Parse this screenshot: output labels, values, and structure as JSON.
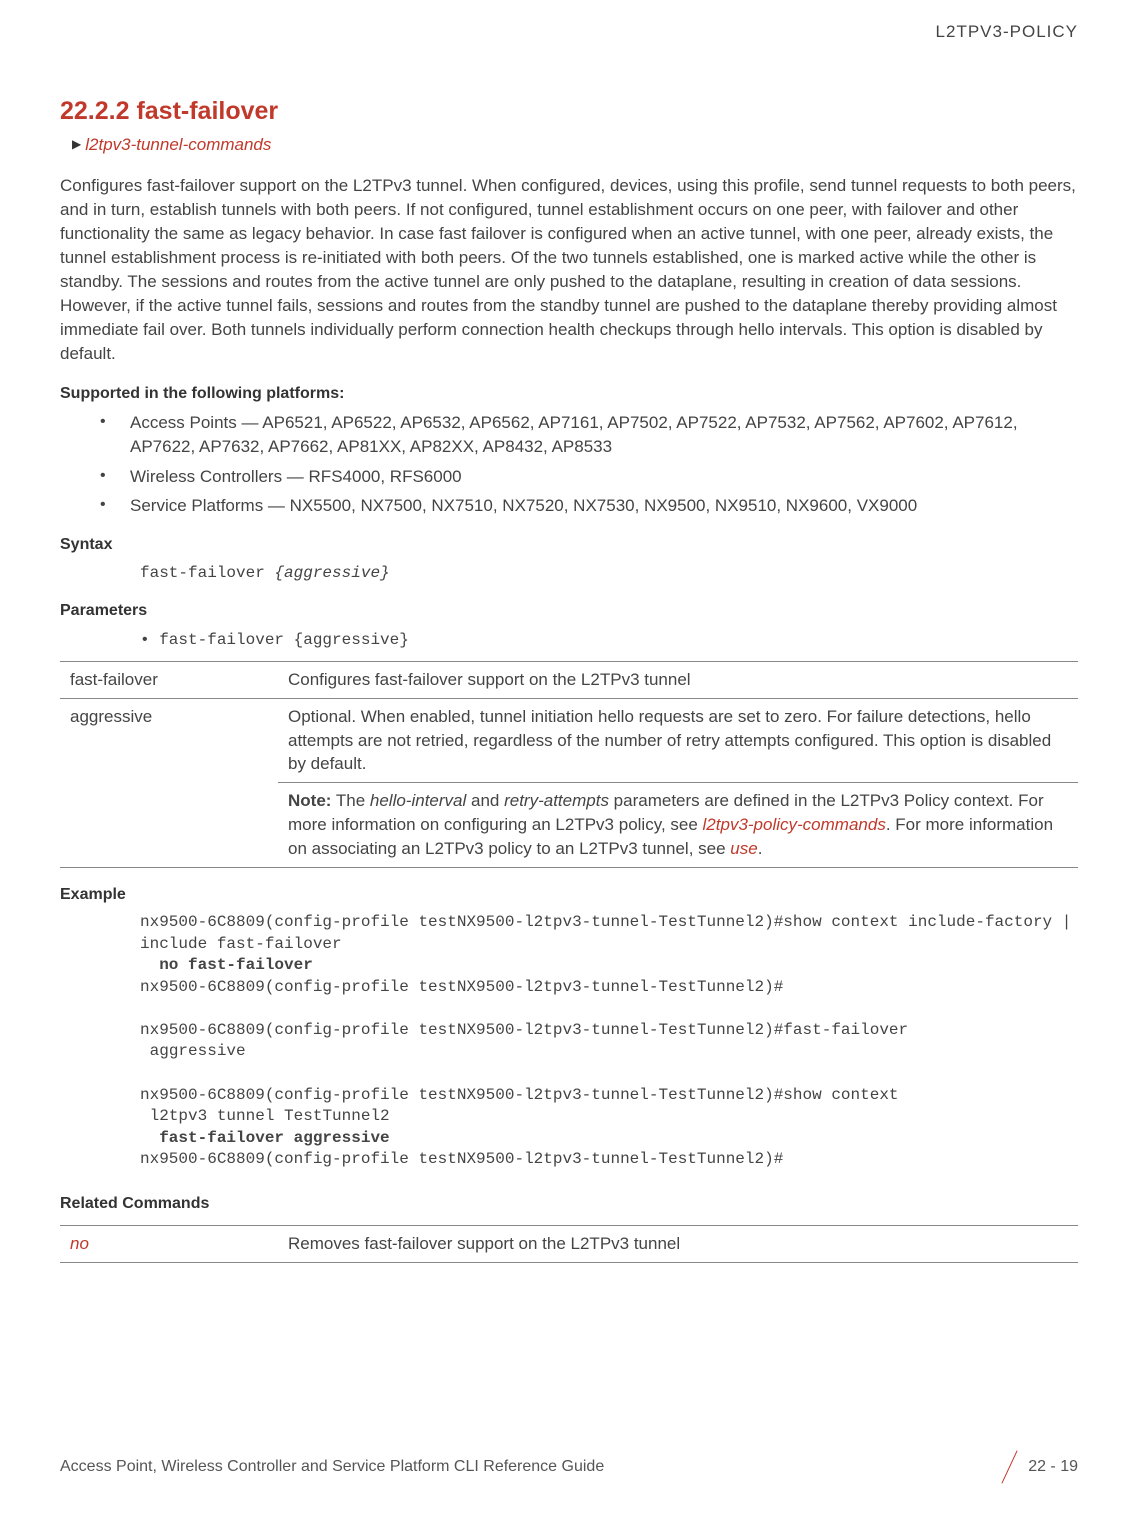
{
  "header": {
    "chapter_label": "L2TPV3-POLICY"
  },
  "section": {
    "number_title": "22.2.2 fast-failover",
    "breadcrumb_link": "l2tpv3-tunnel-commands"
  },
  "intro_paragraph": "Configures fast-failover support on the L2TPv3 tunnel. When configured, devices, using this profile, send tunnel requests to both peers, and in turn, establish tunnels with both peers. If not configured, tunnel establishment occurs on one peer, with failover and other functionality the same as legacy behavior. In case fast failover is configured when an active tunnel, with one peer, already exists, the tunnel establishment process is re-initiated with both peers. Of the two tunnels established, one is marked active while the other is standby. The sessions and routes from the active tunnel are only pushed to the dataplane, resulting in creation of data sessions. However, if the active tunnel fails, sessions and routes from the standby tunnel are pushed to the dataplane thereby providing almost immediate fail over. Both tunnels individually perform connection health checkups through hello intervals. This option is disabled by default.",
  "platforms": {
    "heading": "Supported in the following platforms:",
    "items": [
      "Access Points — AP6521, AP6522, AP6532, AP6562, AP7161, AP7502, AP7522, AP7532, AP7562, AP7602, AP7612, AP7622, AP7632, AP7662, AP81XX, AP82XX, AP8432, AP8533",
      "Wireless Controllers — RFS4000, RFS6000",
      "Service Platforms — NX5500, NX7500, NX7510, NX7520, NX7530, NX9500, NX9510, NX9600, VX9000"
    ]
  },
  "syntax": {
    "heading": "Syntax",
    "command": "fast-failover ",
    "arg": "{aggressive}"
  },
  "parameters": {
    "heading": "Parameters",
    "bullet_cmd": "fast-failover ",
    "bullet_arg": "{aggressive}",
    "rows": [
      {
        "key": "fast-failover",
        "desc": "Configures fast-failover support on the L2TPv3 tunnel"
      }
    ],
    "aggressive": {
      "key": "aggressive",
      "desc": "Optional. When enabled, tunnel initiation hello requests are set to zero. For failure detections, hello attempts are not retried, regardless of the number of retry attempts configured. This option is disabled by default.",
      "note_label": "Note:",
      "note_p1": " The ",
      "note_i1": "hello-interval",
      "note_p2": " and ",
      "note_i2": "retry-attempts",
      "note_p3": " parameters are defined in the L2TPv3 Policy context. For more information on configuring an L2TPv3 policy, see ",
      "note_link1": "l2tpv3-policy-commands",
      "note_p4": ". For more information on associating an L2TPv3 policy to an L2TPv3 tunnel, see ",
      "note_link2": "use",
      "note_p5": "."
    }
  },
  "example": {
    "heading": "Example",
    "line1": "nx9500-6C8809(config-profile testNX9500-l2tpv3-tunnel-TestTunnel2)#show context include-factory | include fast-failover",
    "bold1": "  no fast-failover",
    "line2": "nx9500-6C8809(config-profile testNX9500-l2tpv3-tunnel-TestTunnel2)#",
    "line3": "nx9500-6C8809(config-profile testNX9500-l2tpv3-tunnel-TestTunnel2)#fast-failover\n aggressive",
    "line4": "nx9500-6C8809(config-profile testNX9500-l2tpv3-tunnel-TestTunnel2)#show context\n l2tpv3 tunnel TestTunnel2",
    "bold2": "  fast-failover aggressive",
    "line5": "nx9500-6C8809(config-profile testNX9500-l2tpv3-tunnel-TestTunnel2)#"
  },
  "related": {
    "heading": "Related Commands",
    "rows": [
      {
        "key": "no",
        "desc": "Removes fast-failover support on the L2TPv3 tunnel"
      }
    ]
  },
  "footer": {
    "guide_title": "Access Point, Wireless Controller and Service Platform CLI Reference Guide",
    "page_number": "22 - 19"
  }
}
